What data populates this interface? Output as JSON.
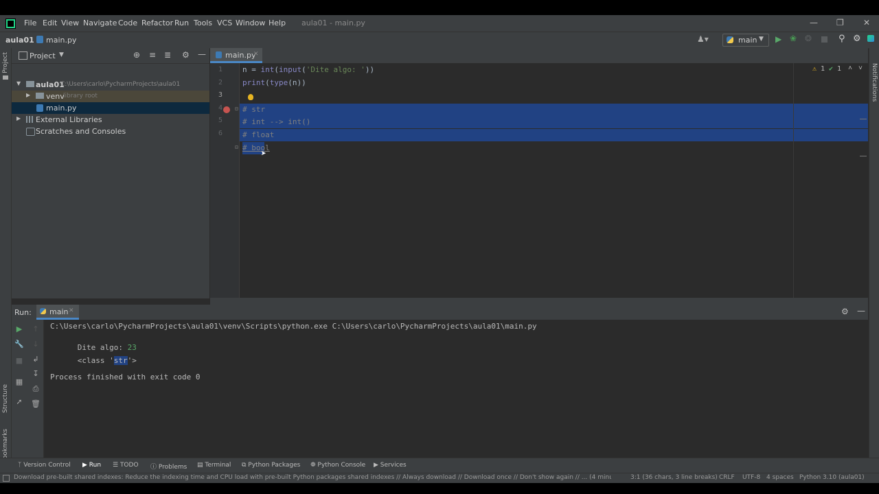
{
  "menubar": {
    "items": [
      "File",
      "Edit",
      "View",
      "Navigate",
      "Code",
      "Refactor",
      "Run",
      "Tools",
      "VCS",
      "Window",
      "Help"
    ],
    "window_title": "aula01 - main.py"
  },
  "navbar": {
    "project": "aula01",
    "file": "main.py",
    "run_config": "main"
  },
  "project_panel": {
    "title": "Project",
    "tree": [
      {
        "label": "aula01",
        "hint": "C:\\Users\\carlo\\PycharmProjects\\aula01"
      },
      {
        "label": "venv",
        "hint": "library root"
      },
      {
        "label": "main.py",
        "hint": ""
      },
      {
        "label": "External Libraries",
        "hint": ""
      },
      {
        "label": "Scratches and Consoles",
        "hint": ""
      }
    ]
  },
  "left_stripe": {
    "project": "Project",
    "structure": "Structure",
    "bookmarks": "Bookmarks"
  },
  "right_stripe": {
    "notifications": "Notifications"
  },
  "editor": {
    "tab": "main.py",
    "inspections": {
      "warnings": "1",
      "weak": "1"
    },
    "line_numbers": [
      "1",
      "2",
      "3",
      "4",
      "5",
      "6"
    ],
    "lines": [
      "n = int(input('Dite algo: '))",
      "print(type(n))",
      "# str",
      "# int --> int()",
      "# float",
      "# bool"
    ]
  },
  "run_panel": {
    "label": "Run:",
    "tab": "main",
    "console": {
      "command": "C:\\Users\\carlo\\PycharmProjects\\aula01\\venv\\Scripts\\python.exe C:\\Users\\carlo\\PycharmProjects\\aula01\\main.py",
      "prompt": "Dite algo: ",
      "input": "23",
      "class_prefix": "<class '",
      "class_name": "str",
      "class_suffix": "'>",
      "exit": "Process finished with exit code 0"
    }
  },
  "tool_windows": [
    "Version Control",
    "Run",
    "TODO",
    "Problems",
    "Terminal",
    "Python Packages",
    "Python Console",
    "Services"
  ],
  "statusbar": {
    "message": "Download pre-built shared indexes: Reduce the indexing time and CPU load with pre-built Python packages shared indexes // Always download // Download once // Don't show again // ... (4 minutes",
    "position": "3:1 (36 chars, 3 line breaks)",
    "line_sep": "CRLF",
    "encoding": "UTF-8",
    "indent": "4 spaces",
    "interpreter": "Python 3.10 (aula01)"
  },
  "colors": {
    "selection": "#214283",
    "keyword": "#cc7832",
    "string": "#6a8759",
    "comment": "#808080",
    "builtin": "#8888c6",
    "run_green": "#59a869",
    "debug_green": "#499c54",
    "breakpoint": "#c75450"
  }
}
